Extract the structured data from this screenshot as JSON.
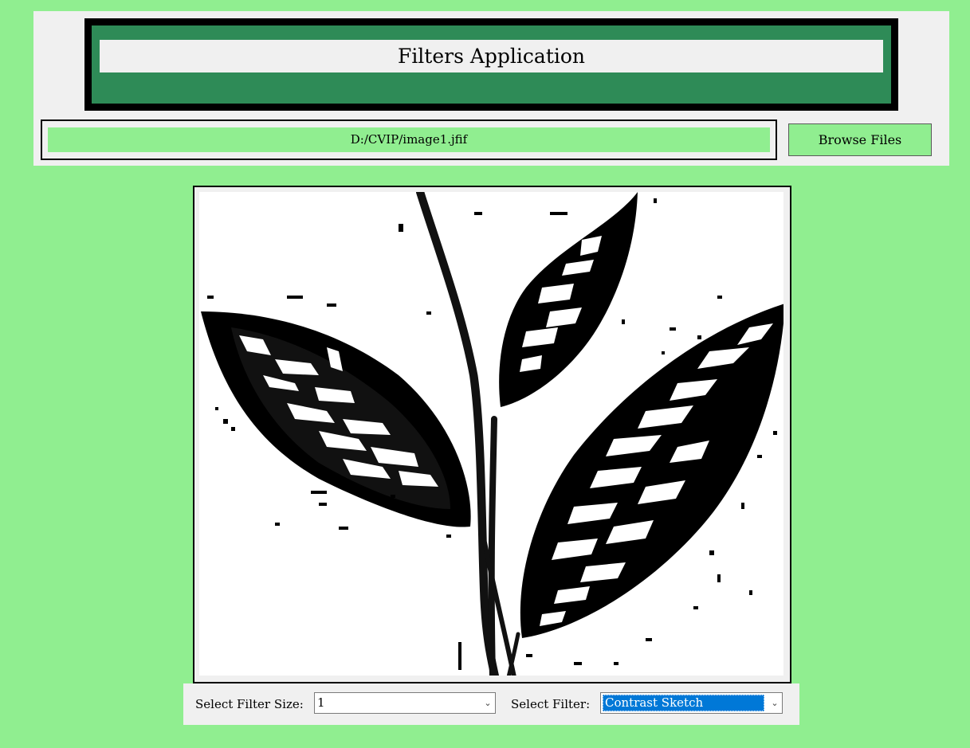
{
  "app": {
    "title": "Filters Application"
  },
  "file": {
    "path": "D:/CVIP/image1.jfif",
    "browse_label": "Browse Files"
  },
  "preview": {
    "description_icon": "filtered-image-contrast-sketch"
  },
  "controls": {
    "filter_size_label": "Select Filter Size:",
    "filter_size_value": "1",
    "filter_label": "Select Filter:",
    "filter_value": "Contrast Sketch"
  },
  "colors": {
    "background": "#90ee90",
    "panel": "#f0f0f0",
    "title_band": "#2e8b57",
    "selection": "#0078d7"
  }
}
